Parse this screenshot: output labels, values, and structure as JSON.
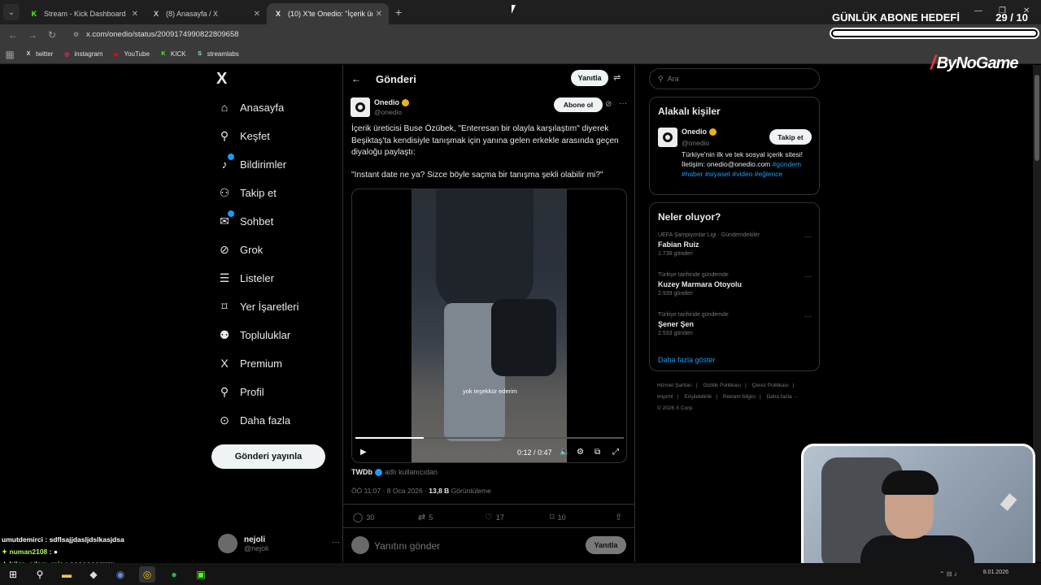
{
  "browser": {
    "tabs": [
      {
        "label": "Stream - Kick Dashboard",
        "icon": "K",
        "color": "#53fc18"
      },
      {
        "label": "(8) Anasayfa / X",
        "icon": "X",
        "color": "#ffffff"
      },
      {
        "label": "(10) X'te Onedio: \"İçerik üretici",
        "icon": "X",
        "color": "#ffffff"
      }
    ],
    "url": "x.com/onedio/status/2009174990822809658",
    "bookmarks": [
      {
        "label": "twitter",
        "icon": "X",
        "color": "#ffffff"
      },
      {
        "label": "instagram",
        "icon": "◎",
        "color": "#e1306c"
      },
      {
        "label": "YouTube",
        "icon": "▶",
        "color": "#ff0000"
      },
      {
        "label": "KICK",
        "icon": "K",
        "color": "#53fc18"
      },
      {
        "label": "streamlabs",
        "icon": "S",
        "color": "#80f5d2"
      }
    ]
  },
  "overlay": {
    "goal_label": "GÜNLÜK ABONE HEDEFİ",
    "goal_count": "29",
    "goal_sep": " / ",
    "goal_target": "10",
    "goal_progress": 1.0,
    "brand": "ByNoGame"
  },
  "nav": {
    "logo": "X",
    "items": [
      {
        "label": "Anasayfa",
        "icon": "home-icon",
        "glyph": "⌂"
      },
      {
        "label": "Keşfet",
        "icon": "search-icon",
        "glyph": "⚲"
      },
      {
        "label": "Bildirimler",
        "icon": "bell-icon",
        "glyph": "🔔"
      },
      {
        "label": "Takip et",
        "icon": "follow-icon",
        "glyph": "👤"
      },
      {
        "label": "Sohbet",
        "icon": "mail-icon",
        "glyph": "✉"
      },
      {
        "label": "Grok",
        "icon": "grok-icon",
        "glyph": "⊘"
      },
      {
        "label": "Listeler",
        "icon": "list-icon",
        "glyph": "☰"
      },
      {
        "label": "Yer İşaretleri",
        "icon": "bookmark-icon",
        "glyph": "⌑"
      },
      {
        "label": "Topluluklar",
        "icon": "communities-icon",
        "glyph": "👥"
      },
      {
        "label": "Premium",
        "icon": "premium-icon",
        "glyph": "X"
      },
      {
        "label": "Profil",
        "icon": "profile-icon",
        "glyph": "👤"
      },
      {
        "label": "Daha fazla",
        "icon": "more-icon",
        "glyph": "⋯"
      }
    ],
    "post_button": "Gönderi yayınla",
    "user_name": "nejoli",
    "user_handle": "@nejoli"
  },
  "post": {
    "header_title": "Gönderi",
    "reply_button": "Yanıtla",
    "author_name": "Onedio",
    "author_handle": "@onedio",
    "follow_button": "Abone ol",
    "text": "İçerik üreticisi Buse Özübek, \"Enteresan bir olayla karşılaştım\" diyerek Beşiktaş'ta kendisiyle tanışmak için yanına gelen erkekle arasında geçen diyaloğu paylaştı:",
    "quote": "\"Instant date ne ya? Sizce böyle saçma bir tanışma şekli olabilir mi?\"",
    "video": {
      "subtitle": "yok teşekkür ederim",
      "time": "0:12 / 0:47",
      "progress": 0.255
    },
    "attribution_user": "TWDb",
    "attribution_text": "adlı kullanıcıdan",
    "time": "ÖÖ 11:07 · 8 Oca 2026 · ",
    "views": "13,8 B",
    "views_label": " Görüntüleme",
    "stats": {
      "replies": "30",
      "reposts": "5",
      "likes": "17",
      "bookmarks": "10"
    },
    "reply_placeholder": "Yanıtını gönder",
    "reply_send": "Yanıtla"
  },
  "sidebar": {
    "search_placeholder": "Ara",
    "related_title": "Alakalı kişiler",
    "related": {
      "name": "Onedio",
      "handle": "@onedio",
      "follow": "Takip et",
      "bio": "Türkiye'nin ilk ve tek sosyal içerik sitesi! İletişim: onedio@onedio.com",
      "hashtags": "#gündem #haber #siyaset #video #eğlence"
    },
    "trends_title": "Neler oluyor?",
    "trends": [
      {
        "category": "UEFA Şampiyonlar Ligi · Gündemdekiler",
        "title": "Fabian Ruiz",
        "count": "1.738 gönderi"
      },
      {
        "category": "Türkiye tarihinde gündemde",
        "title": "Kuzey Marmara Otoyolu",
        "count": "2.939 gönderi"
      },
      {
        "category": "Türkiye tarihinde gündemde",
        "title": "Şener Şen",
        "count": "2.533 gönderi"
      }
    ],
    "show_more": "Daha fazla göster",
    "footer": [
      "Hizmet Şartları",
      "|",
      "Gizlilik Politikası",
      "|",
      "Çerez Politikası",
      "|",
      "Imprint",
      "|",
      "Erişilebilirlik",
      "|",
      "Reklam bilgisi",
      "|",
      "Daha fazla ···",
      "© 2026 X Corp."
    ]
  },
  "chat": [
    {
      "user": "umutdemirci",
      "msg": "sdflsajjdasljdslkasjdsa"
    },
    {
      "user": "numan2108",
      "msg": "●"
    },
    {
      "user": "bilge_adam_reis",
      "msg": "ooooooooww"
    }
  ],
  "taskbar": {
    "date": "8.01.2026"
  }
}
